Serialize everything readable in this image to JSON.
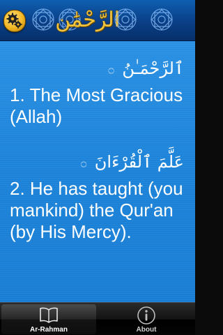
{
  "header": {
    "title_arabic": "الرَّحْمَٰن",
    "settings_icon": "gears-icon",
    "ornament_icon": "geometric-star-ornament"
  },
  "verses": [
    {
      "arabic": "ٱلرَّحْمَـٰنُ",
      "ayah_mark": "۝",
      "translation": "1. The Most Gracious (Allah)"
    },
    {
      "arabic": "عَلَّمَ ٱلْقُرْءَانَ",
      "ayah_mark": "۝",
      "translation": "2. He has taught (you mankind) the Qur'an (by His Mercy)."
    }
  ],
  "tabbar": {
    "tabs": [
      {
        "label": "Ar-Rahman",
        "icon": "book-icon",
        "selected": true
      },
      {
        "label": "About",
        "icon": "info-icon",
        "selected": false
      }
    ]
  },
  "colors": {
    "header_blue": "#0a3f86",
    "content_blue": "#1e86dc",
    "gold": "#f2c43b",
    "tabbar_black": "#0b0b0b"
  }
}
